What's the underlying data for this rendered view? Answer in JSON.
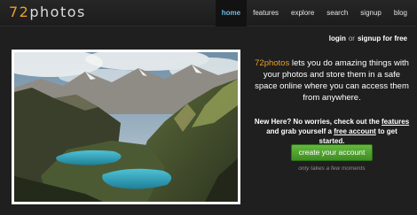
{
  "logo": {
    "number": "72",
    "word": "photos"
  },
  "nav": {
    "items": [
      "home",
      "features",
      "explore",
      "search",
      "signup",
      "blog"
    ]
  },
  "account": {
    "login": "login",
    "or": "or",
    "signup": "signup for free"
  },
  "intro": {
    "brand": "72photos",
    "text": " lets you do amazing things with your photos and store them in a safe space online where you can access them from anywhere."
  },
  "promo": {
    "line1": "New Here? No worries, check out the ",
    "features_link": "features",
    "line2": " and grab yourself a ",
    "free_account_link": "free account",
    "line3": " to get started."
  },
  "cta": {
    "label": "create your account"
  },
  "note": "only takes a few moments",
  "colors": {
    "brand_orange": "#e8a029",
    "active_nav": "#6fbbe0",
    "cta_green": "#4fa22e"
  }
}
